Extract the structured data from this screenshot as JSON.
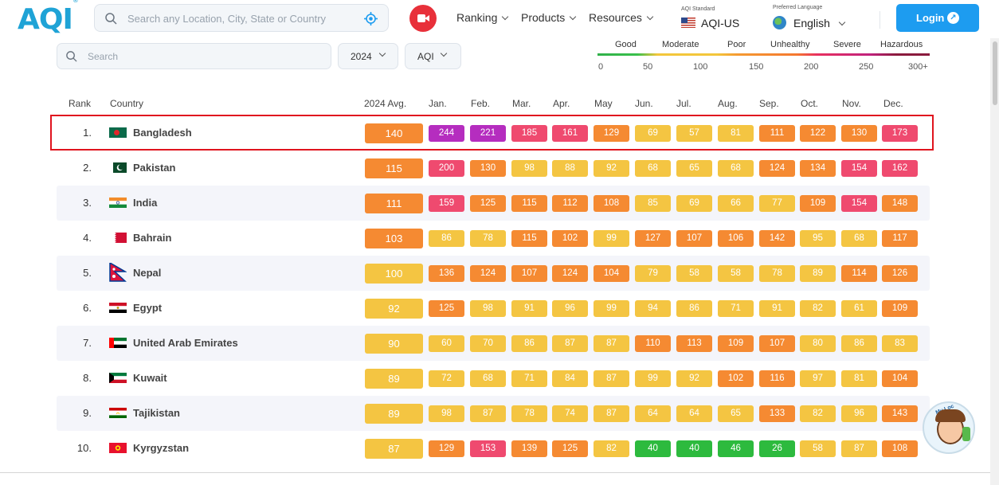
{
  "header": {
    "logo_text": "AQI",
    "search_placeholder": "Search any Location, City, State or Country",
    "nav": [
      "Ranking",
      "Products",
      "Resources"
    ],
    "aqi_standard_label": "AQI Standard",
    "aqi_standard_value": "AQI-US",
    "language_label": "Preferred Language",
    "language_value": "English",
    "login_label": "Login"
  },
  "filters": {
    "search_placeholder": "Search",
    "year": "2024",
    "metric": "AQI"
  },
  "legend": {
    "categories": [
      "Good",
      "Moderate",
      "Poor",
      "Unhealthy",
      "Severe",
      "Hazardous"
    ],
    "ticks": [
      "0",
      "50",
      "100",
      "150",
      "200",
      "250",
      "300+"
    ]
  },
  "table": {
    "headers": [
      "Rank",
      "Country",
      "2024 Avg.",
      "Jan.",
      "Feb.",
      "Mar.",
      "Apr.",
      "May",
      "Jun.",
      "Jul.",
      "Aug.",
      "Sep.",
      "Oct.",
      "Nov.",
      "Dec."
    ],
    "rows": [
      {
        "rank": "1.",
        "country": "Bangladesh",
        "flag": "bangladesh-flag",
        "avg": "140",
        "months": [
          "244",
          "221",
          "185",
          "161",
          "129",
          "69",
          "57",
          "81",
          "111",
          "122",
          "130",
          "173"
        ]
      },
      {
        "rank": "2.",
        "country": "Pakistan",
        "flag": "pakistan-flag",
        "avg": "115",
        "months": [
          "200",
          "130",
          "98",
          "88",
          "92",
          "68",
          "65",
          "68",
          "124",
          "134",
          "154",
          "162"
        ]
      },
      {
        "rank": "3.",
        "country": "India",
        "flag": "india-flag",
        "avg": "111",
        "months": [
          "159",
          "125",
          "115",
          "112",
          "108",
          "85",
          "69",
          "66",
          "77",
          "109",
          "154",
          "148"
        ]
      },
      {
        "rank": "4.",
        "country": "Bahrain",
        "flag": "bahrain-flag",
        "avg": "103",
        "months": [
          "86",
          "78",
          "115",
          "102",
          "99",
          "127",
          "107",
          "106",
          "142",
          "95",
          "68",
          "117"
        ]
      },
      {
        "rank": "5.",
        "country": "Nepal",
        "flag": "nepal-flag",
        "avg": "100",
        "months": [
          "136",
          "124",
          "107",
          "124",
          "104",
          "79",
          "58",
          "58",
          "78",
          "89",
          "114",
          "126"
        ]
      },
      {
        "rank": "6.",
        "country": "Egypt",
        "flag": "egypt-flag",
        "avg": "92",
        "months": [
          "125",
          "98",
          "91",
          "96",
          "99",
          "94",
          "86",
          "71",
          "91",
          "82",
          "61",
          "109"
        ]
      },
      {
        "rank": "7.",
        "country": "United Arab Emirates",
        "flag": "uae-flag",
        "avg": "90",
        "months": [
          "60",
          "70",
          "86",
          "87",
          "87",
          "110",
          "113",
          "109",
          "107",
          "80",
          "86",
          "83"
        ]
      },
      {
        "rank": "8.",
        "country": "Kuwait",
        "flag": "kuwait-flag",
        "avg": "89",
        "months": [
          "72",
          "68",
          "71",
          "84",
          "87",
          "99",
          "92",
          "102",
          "116",
          "97",
          "81",
          "104"
        ]
      },
      {
        "rank": "9.",
        "country": "Tajikistan",
        "flag": "tajikistan-flag",
        "avg": "89",
        "months": [
          "98",
          "87",
          "78",
          "74",
          "87",
          "64",
          "64",
          "65",
          "133",
          "82",
          "96",
          "143"
        ]
      },
      {
        "rank": "10.",
        "country": "Kyrgyzstan",
        "flag": "kyrgyzstan-flag",
        "avg": "87",
        "months": [
          "129",
          "153",
          "139",
          "125",
          "82",
          "40",
          "40",
          "46",
          "26",
          "58",
          "87",
          "108"
        ]
      }
    ]
  },
  "colors": {
    "good": "#2dba3e",
    "moderate": "#f4c542",
    "poor": "#f58a32",
    "unhealthy": "#ef4a6f",
    "severe": "#b52dbf",
    "highlight": "#e0141e",
    "login": "#1d9cf0"
  },
  "mascot_text": "My Loc"
}
